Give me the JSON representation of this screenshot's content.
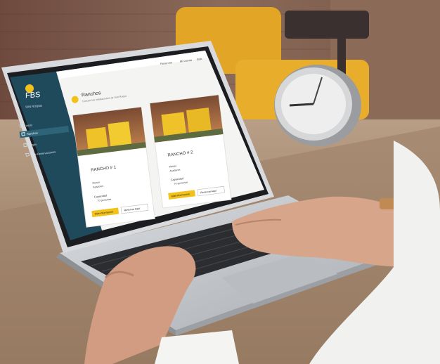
{
  "app": {
    "logo_text": "FBS",
    "logo_caption": "SAN ROQUE",
    "top_links": [
      "Reservas",
      "Mi cuenta",
      "Salir"
    ]
  },
  "sidebar": {
    "items": [
      {
        "label": "Inicio",
        "icon": "home-icon"
      },
      {
        "label": "Ranchos",
        "icon": "grid-icon",
        "active": true
      },
      {
        "label": "Login",
        "icon": "login-icon"
      },
      {
        "label": "Mis Reservaciones",
        "icon": "tag-icon"
      }
    ]
  },
  "page": {
    "title": "Ranchos",
    "subtitle": "Conoce las instalaciones de San Roque"
  },
  "cards": [
    {
      "title": "RANCHO # 1",
      "features": [
        "Mesas",
        "Asadores"
      ],
      "capacity_label": "Capacidad",
      "capacity_value": "70 personas",
      "primary_button": "Más información",
      "secondary_button": "Reservar Aquí"
    },
    {
      "title": "RANCHO # 2",
      "features": [
        "Mesas",
        "Asadores"
      ],
      "capacity_label": "Capacidad",
      "capacity_value": "70 personas",
      "primary_button": "Más información",
      "secondary_button": "Reservar Aquí"
    }
  ],
  "colors": {
    "sidebar": "#1f4a5c",
    "accent_yellow": "#f2c21b",
    "laptop_silver": "#c9ccd0",
    "wood": "#a88a6e"
  }
}
